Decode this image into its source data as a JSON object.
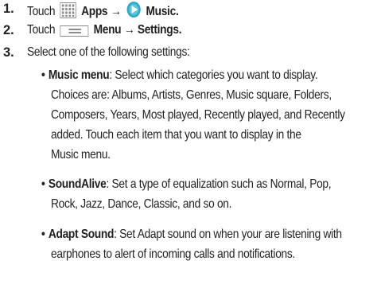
{
  "steps": [
    {
      "number": "1.",
      "prefix": "Touch",
      "icon1": "apps-grid-icon",
      "label1": "Apps",
      "arrow": "→",
      "icon2": "music-app-icon",
      "label2": "Music",
      "end": "."
    },
    {
      "number": "2.",
      "prefix": "Touch",
      "icon1": "menu-key-icon",
      "label1": "Menu",
      "arrow": "→",
      "label2": "Settings",
      "end": "."
    },
    {
      "number": "3.",
      "text": "Select one of the following settings:"
    }
  ],
  "settings": [
    {
      "name": "Music menu",
      "lines": [
        ": Select which categories you want to display.",
        "Choices are: Albums, Artists, Genres, Music square, Folders,",
        "Composers, Years, Most played, Recently played, and Recently",
        "added. Touch each item that you want to display in the",
        "Music menu."
      ]
    },
    {
      "name": "SoundAlive",
      "lines": [
        ": Set a type of equalization such as Normal, Pop,",
        "Rock, Jazz, Dance, Classic, and so on."
      ]
    },
    {
      "name": "Adapt Sound",
      "lines": [
        ": Set Adapt sound on when your are listening with",
        "earphones to alert of incoming calls and notifications."
      ]
    }
  ],
  "bullet_char": "•",
  "colors": {
    "text": "#231f20",
    "icon_gray": "#8a8a8a",
    "music_icon": "#2ea9c6"
  }
}
